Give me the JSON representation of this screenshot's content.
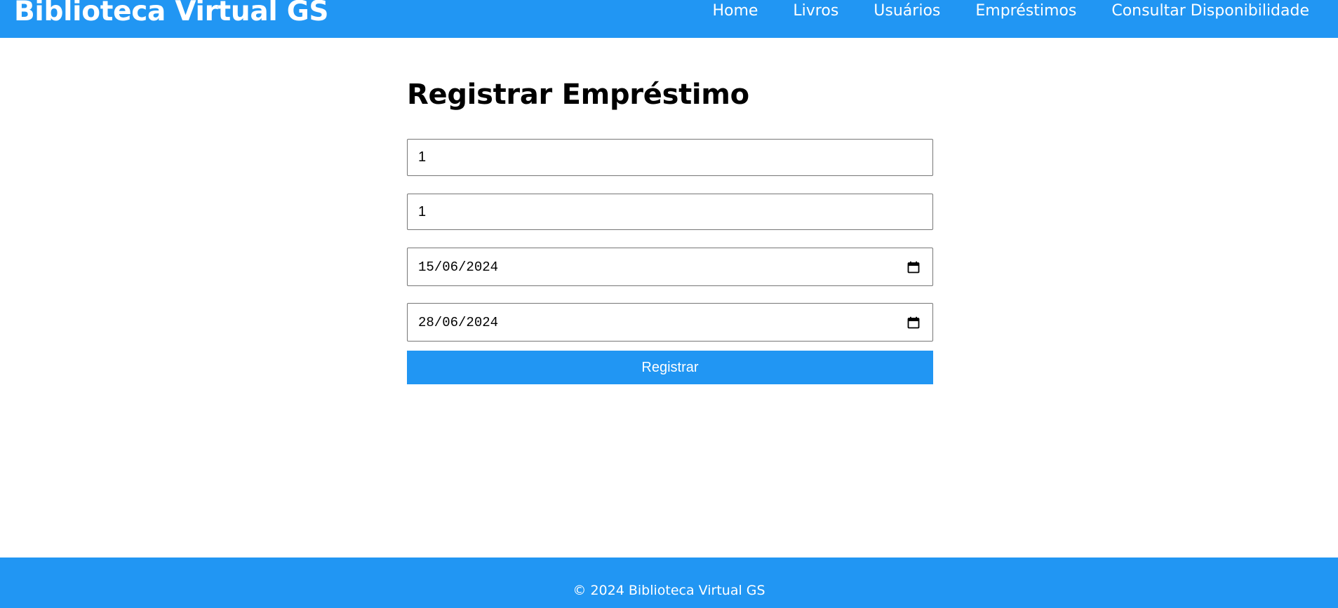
{
  "header": {
    "brand": "Biblioteca Virtual GS",
    "nav": [
      {
        "label": "Home"
      },
      {
        "label": "Livros"
      },
      {
        "label": "Usuários"
      },
      {
        "label": "Empréstimos"
      },
      {
        "label": "Consultar Disponibilidade"
      }
    ]
  },
  "form": {
    "title": "Registrar Empréstimo",
    "fields": [
      {
        "value": "1"
      },
      {
        "value": "1"
      },
      {
        "value": "15/06/2024"
      },
      {
        "value": "28/06/2024"
      }
    ],
    "submit_label": "Registrar"
  },
  "footer": {
    "text": "© 2024 Biblioteca Virtual GS"
  },
  "colors": {
    "accent": "#2196f3",
    "background": "#ffffff",
    "input_border": "#767676"
  },
  "icons": {
    "date_picker": "calendar-icon"
  }
}
